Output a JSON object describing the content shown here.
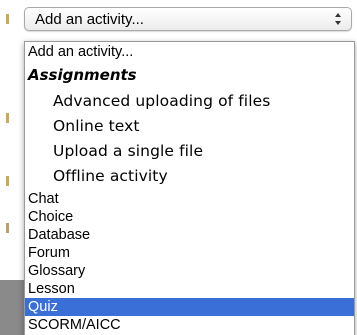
{
  "select": {
    "value": "Add an activity...",
    "arrows_icon": "updown-arrows-icon"
  },
  "dropdown": {
    "options": [
      {
        "label": "Add an activity..."
      },
      {
        "label": "Assignments",
        "group": true
      },
      {
        "label": "Advanced uploading of files"
      },
      {
        "label": "Online text"
      },
      {
        "label": "Upload a single file"
      },
      {
        "label": "Offline activity"
      },
      {
        "label": "Chat"
      },
      {
        "label": "Choice"
      },
      {
        "label": "Database"
      },
      {
        "label": "Forum"
      },
      {
        "label": "Glossary"
      },
      {
        "label": "Lesson"
      },
      {
        "label": "Quiz",
        "selected": true
      },
      {
        "label": "SCORM/AICC"
      }
    ],
    "selected_color": "#3a6fd8"
  }
}
